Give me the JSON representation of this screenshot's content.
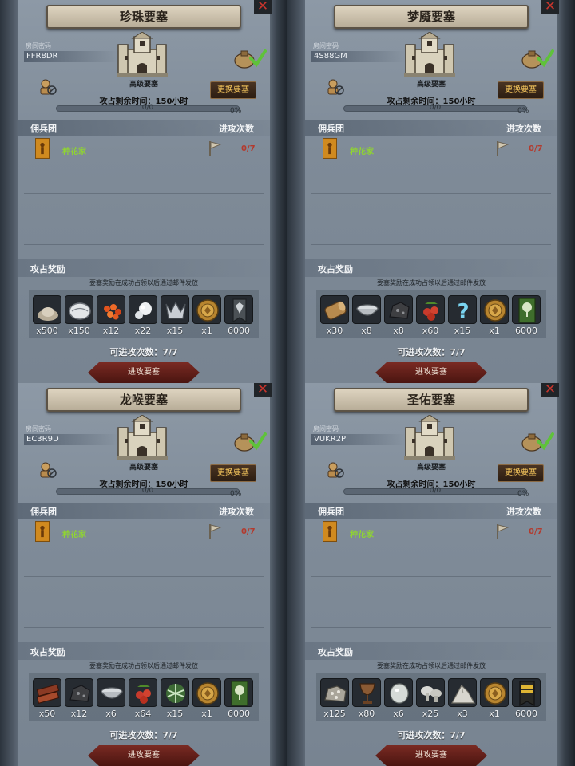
{
  "colors": {
    "panel_bg": "#7f8b98",
    "banner": "#ccc1ab",
    "merc_name": "#8fd334",
    "count_red": "#b33a2d",
    "change_btn_text": "#f2c35b",
    "attack_btn": "#6a2019"
  },
  "panels": [
    {
      "title": "珍珠要塞",
      "room_label": "房间密码",
      "room_code": "FFR8DR",
      "tier": "高级要塞",
      "change_button": "更换要塞",
      "attack_time": "攻占剩余时间：150小时",
      "progress_text": "0/0",
      "progress_pct": "0%",
      "progress_value": 0,
      "merc_title": "佣兵团",
      "attack_count_title": "进攻次数",
      "merc_name": "种花家",
      "merc_count": "0/7",
      "reward_title": "攻占奖励",
      "reward_note": "要塞奖励在成功占领以后通过邮件发放",
      "rewards": [
        {
          "icon": "ore-pile-icon",
          "qty": "x500"
        },
        {
          "icon": "oyster-shell-icon",
          "qty": "x150"
        },
        {
          "icon": "fish-roe-icon",
          "qty": "x12"
        },
        {
          "icon": "pearls-icon",
          "qty": "x22"
        },
        {
          "icon": "crown-emblem-icon",
          "qty": "x15"
        },
        {
          "icon": "gold-medal-icon",
          "qty": "x1"
        },
        {
          "icon": "banner-icon",
          "qty": "6000"
        }
      ],
      "remaining": "可进攻次数：7/7",
      "attack_button": "进攻要塞"
    },
    {
      "title": "梦魇要塞",
      "room_label": "房间密码",
      "room_code": "4S88GM",
      "tier": "高级要塞",
      "change_button": "更换要塞",
      "attack_time": "攻占剩余时间：150小时",
      "progress_text": "0/0",
      "progress_pct": "0%",
      "progress_value": 0,
      "merc_title": "佣兵团",
      "attack_count_title": "进攻次数",
      "merc_name": "种花家",
      "merc_count": "0/7",
      "reward_title": "攻占奖励",
      "reward_note": "要塞奖励在成功占领以后通过邮件发放",
      "rewards": [
        {
          "icon": "wood-log-icon",
          "qty": "x30"
        },
        {
          "icon": "bowl-icon",
          "qty": "x8"
        },
        {
          "icon": "coal-ore-icon",
          "qty": "x8"
        },
        {
          "icon": "berries-icon",
          "qty": "x60"
        },
        {
          "icon": "question-rune-icon",
          "qty": "x15"
        },
        {
          "icon": "gold-medal-icon",
          "qty": "x1"
        },
        {
          "icon": "tree-banner-icon",
          "qty": "6000"
        }
      ],
      "remaining": "可进攻次数：7/7",
      "attack_button": "进攻要塞"
    },
    {
      "title": "龙喉要塞",
      "room_label": "房间密码",
      "room_code": "EC3R9D",
      "tier": "高级要塞",
      "change_button": "更换要塞",
      "attack_time": "攻占剩余时间：150小时",
      "progress_text": "0/0",
      "progress_pct": "0%",
      "progress_value": 0,
      "merc_title": "佣兵团",
      "attack_count_title": "进攻次数",
      "merc_name": "种花家",
      "merc_count": "0/7",
      "reward_title": "攻占奖励",
      "reward_note": "要塞奖励在成功占领以后通过邮件发放",
      "rewards": [
        {
          "icon": "leather-icon",
          "qty": "x50"
        },
        {
          "icon": "coal-ore-icon",
          "qty": "x12"
        },
        {
          "icon": "bowl-icon",
          "qty": "x6"
        },
        {
          "icon": "berries-icon",
          "qty": "x64"
        },
        {
          "icon": "herb-icon",
          "qty": "x15"
        },
        {
          "icon": "gold-medal-icon",
          "qty": "x1"
        },
        {
          "icon": "tree-banner-icon",
          "qty": "6000"
        }
      ],
      "remaining": "可进攻次数：7/7",
      "attack_button": "进攻要塞"
    },
    {
      "title": "圣佑要塞",
      "room_label": "房间密码",
      "room_code": "VUKR2P",
      "tier": "高级要塞",
      "change_button": "更换要塞",
      "attack_time": "攻占剩余时间：150小时",
      "progress_text": "0/0",
      "progress_pct": "0%",
      "progress_value": 0,
      "merc_title": "佣兵团",
      "attack_count_title": "进攻次数",
      "merc_name": "种花家",
      "merc_count": "0/7",
      "reward_title": "攻占奖励",
      "reward_note": "要塞奖励在成功占领以后通过邮件发放",
      "rewards": [
        {
          "icon": "silver-ore-icon",
          "qty": "x125"
        },
        {
          "icon": "goblet-icon",
          "qty": "x80"
        },
        {
          "icon": "white-stone-icon",
          "qty": "x6"
        },
        {
          "icon": "mushrooms-icon",
          "qty": "x25"
        },
        {
          "icon": "salt-pile-icon",
          "qty": "x3"
        },
        {
          "icon": "gold-medal-icon",
          "qty": "x1"
        },
        {
          "icon": "rank-banner-icon",
          "qty": "6000"
        }
      ],
      "remaining": "可进攻次数：7/7",
      "attack_button": "进攻要塞"
    }
  ]
}
